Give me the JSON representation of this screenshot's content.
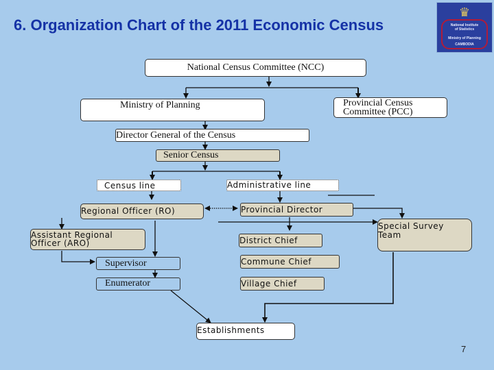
{
  "header": {
    "title": "6. Organization Chart of the 2011 Economic Census",
    "logo": {
      "line1": "National Institute",
      "line2": "of Statistics",
      "line3": "Ministry of Planning",
      "line4": "CAMBODIA",
      "emblem_icon": "royal-emblem-icon"
    }
  },
  "nodes": {
    "ncc": "National Census Committee (NCC)",
    "ministry": "Ministry of Planning",
    "pcc_line1": "Provincial Census",
    "pcc_line2": "Committee (PCC)",
    "director_general": "Director General of the Census",
    "senior_census": "Senior Census",
    "census_line": "Census line",
    "administrative_line": "Administrative line",
    "regional_officer": "Regional Officer (RO)",
    "provincial_director": "Provincial Director",
    "aro_line1": "Assistant Regional",
    "aro_line2": "Officer (ARO)",
    "supervisor": "Supervisor",
    "enumerator": "Enumerator",
    "district_chief": "District Chief",
    "commune_chief": "Commune Chief",
    "village_chief": "Village Chief",
    "special_survey_line1": "Special Survey",
    "special_survey_line2": "Team",
    "establishments": "Establishments"
  },
  "colors": {
    "background": "#a7cbec",
    "title": "#1532a6",
    "box_white": "#ffffff",
    "box_tan": "#ddd8c4"
  },
  "footer": {
    "page_number": "7"
  }
}
